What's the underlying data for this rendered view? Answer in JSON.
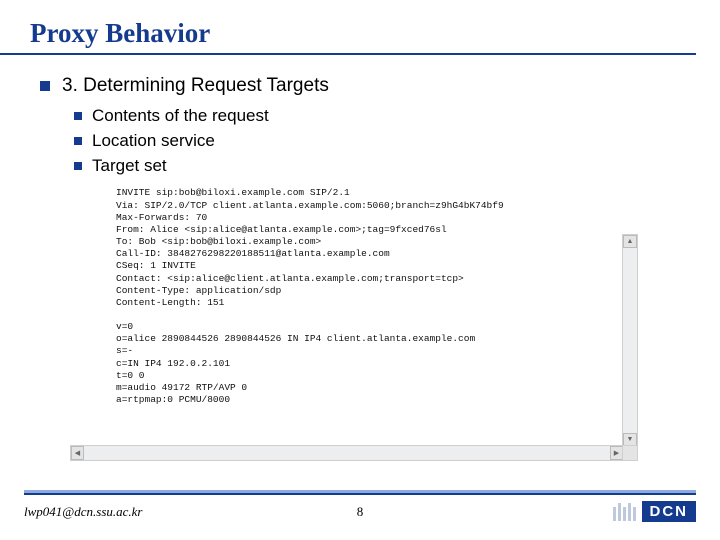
{
  "title": "Proxy Behavior",
  "section": {
    "heading": "3. Determining Request Targets",
    "items": [
      "Contents of the request",
      "Location service",
      "Target set"
    ]
  },
  "sip": {
    "lines": [
      "INVITE sip:bob@biloxi.example.com SIP/2.1",
      "Via: SIP/2.0/TCP client.atlanta.example.com:5060;branch=z9hG4bK74bf9",
      "Max-Forwards: 70",
      "From: Alice <sip:alice@atlanta.example.com>;tag=9fxced76sl",
      "To: Bob <sip:bob@biloxi.example.com>",
      "Call-ID: 3848276298220188511@atlanta.example.com",
      "CSeq: 1 INVITE",
      "Contact: <sip:alice@client.atlanta.example.com;transport=tcp>",
      "Content-Type: application/sdp",
      "Content-Length: 151",
      "",
      "v=0",
      "o=alice 2890844526 2890844526 IN IP4 client.atlanta.example.com",
      "s=-",
      "c=IN IP4 192.0.2.101",
      "t=0 0",
      "m=audio 49172 RTP/AVP 0",
      "a=rtpmap:0 PCMU/8000"
    ]
  },
  "footer": {
    "email": "lwp041@dcn.ssu.ac.kr",
    "page": "8",
    "logo": "DCN"
  }
}
